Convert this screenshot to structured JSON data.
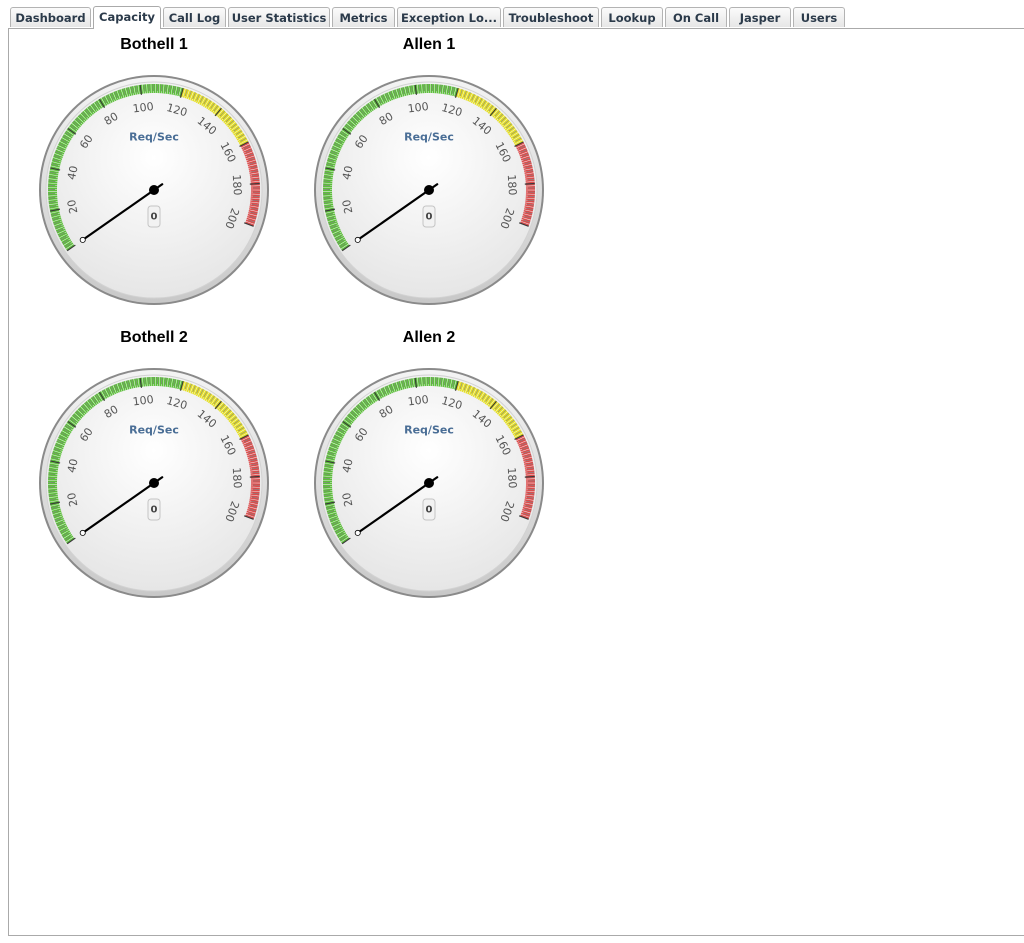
{
  "tabs": [
    {
      "label": "Dashboard",
      "active": false
    },
    {
      "label": "Capacity",
      "active": true
    },
    {
      "label": "Call Log",
      "active": false
    },
    {
      "label": "User Statistics",
      "active": false
    },
    {
      "label": "Metrics",
      "active": false
    },
    {
      "label": "Exception Lo...",
      "active": false
    },
    {
      "label": "Troubleshoot",
      "active": false
    },
    {
      "label": "Lookup",
      "active": false
    },
    {
      "label": "On Call",
      "active": false
    },
    {
      "label": "Jasper",
      "active": false
    },
    {
      "label": "Users",
      "active": false
    }
  ],
  "gauges": [
    {
      "title": "Bothell 1",
      "unit": "Req/Sec",
      "value": 0,
      "value_label": "0"
    },
    {
      "title": "Allen 1",
      "unit": "Req/Sec",
      "value": 0,
      "value_label": "0"
    },
    {
      "title": "Bothell 2",
      "unit": "Req/Sec",
      "value": 0,
      "value_label": "0"
    },
    {
      "title": "Allen 2",
      "unit": "Req/Sec",
      "value": 0,
      "value_label": "0"
    }
  ],
  "gauge_scale": {
    "min": 0,
    "max": 200,
    "tick_labels": [
      "20",
      "40",
      "60",
      "80",
      "100",
      "120",
      "140",
      "160",
      "180",
      "200"
    ],
    "bands": [
      {
        "from": 0,
        "to": 120,
        "color": "#5cbf3a"
      },
      {
        "from": 120,
        "to": 160,
        "color": "#e6e020"
      },
      {
        "from": 160,
        "to": 200,
        "color": "#dd4c4c"
      }
    ]
  }
}
